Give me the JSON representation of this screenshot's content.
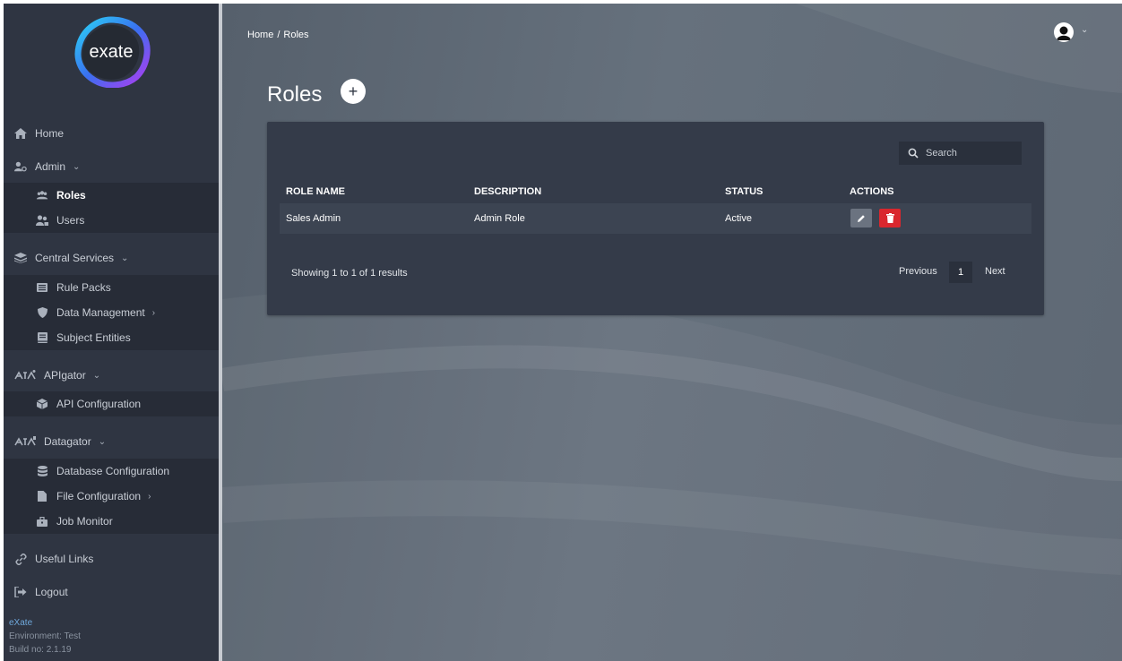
{
  "app": {
    "logo_text": "exate"
  },
  "sidebar": {
    "items": [
      {
        "label": "Home",
        "icon": "home-icon"
      },
      {
        "label": "Admin",
        "icon": "users-gear-icon",
        "chevron": "chevron-down-icon"
      },
      {
        "label": "Roles",
        "icon": "roles-icon",
        "active": true
      },
      {
        "label": "Users",
        "icon": "users-icon"
      },
      {
        "label": "Central Services",
        "icon": "layers-icon",
        "chevron": "chevron-down-icon"
      },
      {
        "label": "Rule Packs",
        "icon": "list-icon"
      },
      {
        "label": "Data Management",
        "icon": "shield-icon",
        "chevron": "chevron-right-icon"
      },
      {
        "label": "Subject Entities",
        "icon": "book-icon"
      },
      {
        "label": "APIgator",
        "icon": "apigator-icon",
        "chevron": "chevron-down-icon"
      },
      {
        "label": "API Configuration",
        "icon": "cube-icon"
      },
      {
        "label": "Datagator",
        "icon": "datagator-icon",
        "chevron": "chevron-down-icon"
      },
      {
        "label": "Database Configuration",
        "icon": "database-icon"
      },
      {
        "label": "File Configuration",
        "icon": "file-icon",
        "chevron": "chevron-right-icon"
      },
      {
        "label": "Job Monitor",
        "icon": "briefcase-icon"
      },
      {
        "label": "Useful Links",
        "icon": "link-icon"
      },
      {
        "label": "Logout",
        "icon": "logout-icon"
      }
    ],
    "footer": {
      "brand": "eXate",
      "environment": "Environment: Test",
      "build": "Build no: 2.1.19"
    }
  },
  "breadcrumb": {
    "home": "Home",
    "separator": "/",
    "current": "Roles"
  },
  "header": {
    "user_icon": "user-avatar-icon"
  },
  "page": {
    "title": "Roles",
    "add_label": "+"
  },
  "search": {
    "placeholder": "Search"
  },
  "table": {
    "columns": [
      "ROLE NAME",
      "DESCRIPTION",
      "STATUS",
      "ACTIONS"
    ],
    "rows": [
      {
        "role_name": "Sales Admin",
        "description": "Admin Role",
        "status": "Active"
      }
    ]
  },
  "pagination": {
    "showing_prefix": "Showing ",
    "from": "1",
    "to_word": " to ",
    "to": "1",
    "of_text": " of 1 results",
    "previous": "Previous",
    "current_page": "1",
    "next": "Next"
  },
  "colors": {
    "sidebar_bg": "#2f3542",
    "card_bg": "#343b49",
    "delete": "#d9272e",
    "link_blue": "#6fa8dc"
  }
}
